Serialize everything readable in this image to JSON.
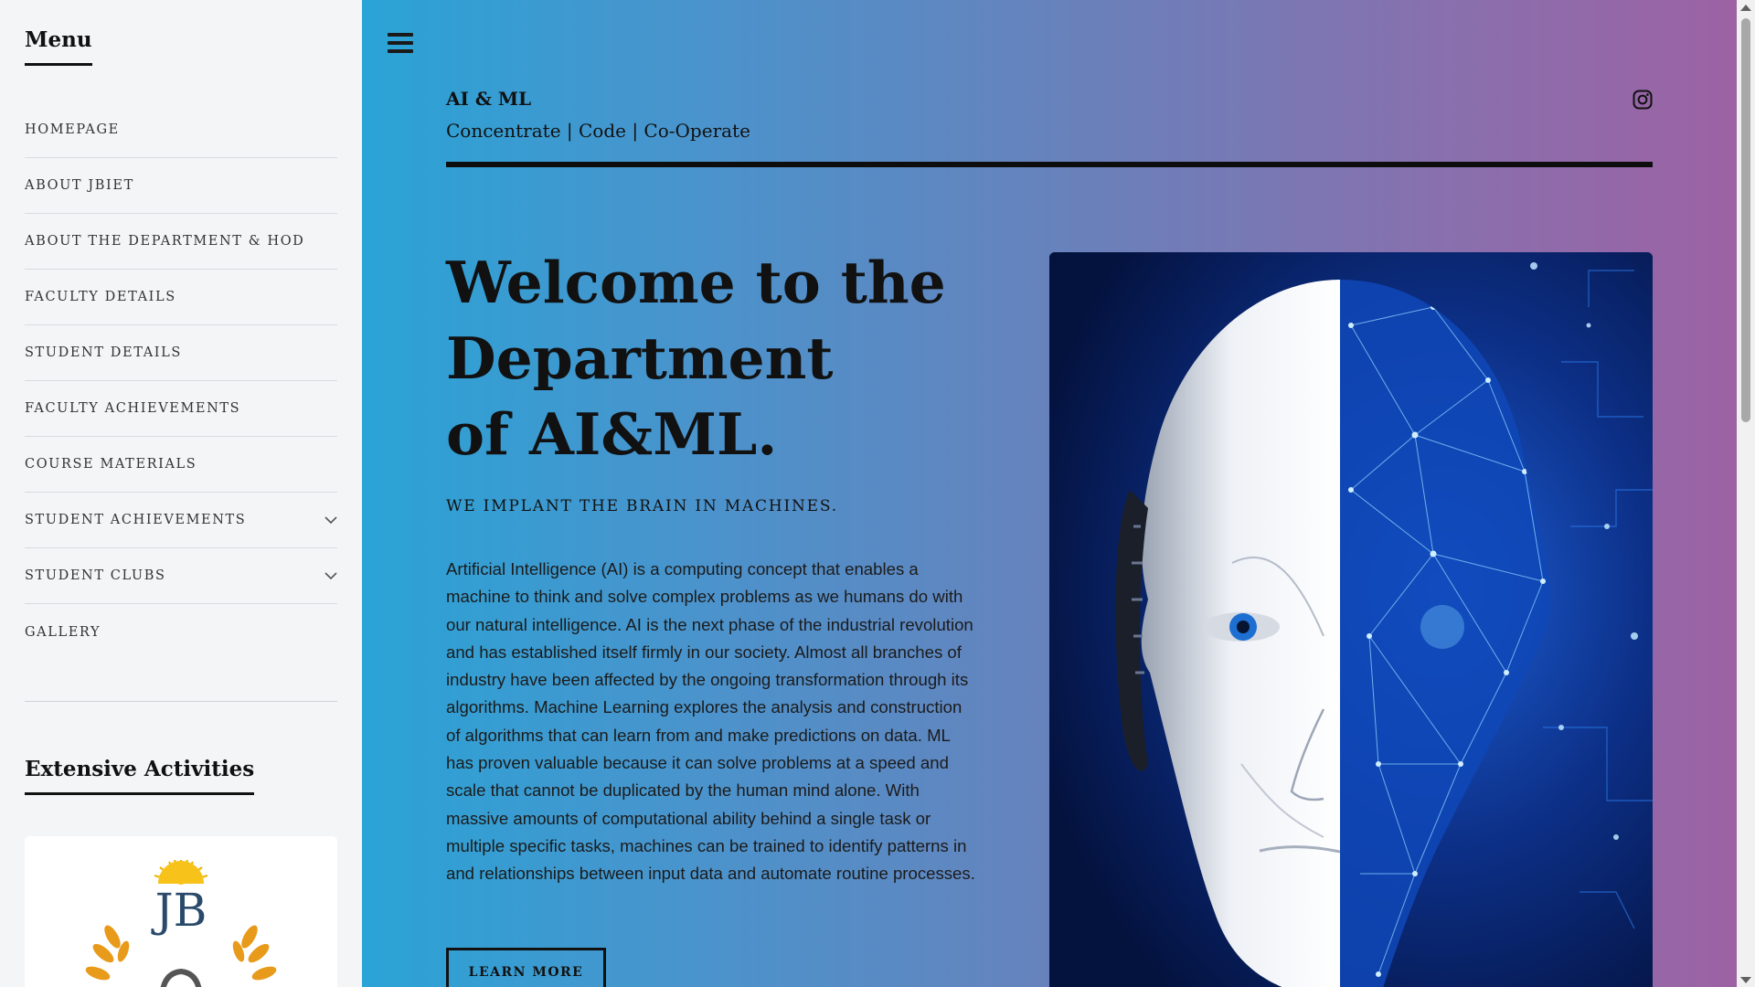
{
  "sidebar": {
    "menu_title": "Menu",
    "items": [
      {
        "label": "HOMEPAGE",
        "has_submenu": false
      },
      {
        "label": "ABOUT JBIET",
        "has_submenu": false
      },
      {
        "label": "ABOUT THE DEPARTMENT & HOD",
        "has_submenu": false
      },
      {
        "label": "FACULTY DETAILS",
        "has_submenu": false
      },
      {
        "label": "STUDENT DETAILS",
        "has_submenu": false
      },
      {
        "label": "FACULTY ACHIEVEMENTS",
        "has_submenu": false
      },
      {
        "label": "COURSE MATERIALS",
        "has_submenu": false
      },
      {
        "label": "STUDENT ACHIEVEMENTS",
        "has_submenu": true
      },
      {
        "label": "STUDENT CLUBS",
        "has_submenu": true
      },
      {
        "label": "GALLERY",
        "has_submenu": false
      }
    ],
    "activities_title": "Extensive Activities",
    "logo_text": "JB"
  },
  "header": {
    "site_title": "AI & ML",
    "tagline": "Concentrate | Code | Co-Operate",
    "social_icon": "instagram-icon"
  },
  "hero": {
    "heading_lines": [
      "Welcome to the",
      "Department",
      "of AI&ML."
    ],
    "subheading": "WE IMPLANT THE BRAIN IN MACHINES.",
    "body": "Artificial Intelligence (AI) is a computing concept that enables a machine to think and solve complex problems as we humans do with our natural intelligence. AI is the next phase of the industrial revolution and has established itself firmly in our society. Almost all branches of industry have been affected by the ongoing transformation through its algorithms. Machine Learning explores the analysis and construction of algorithms that can learn from and make predictions on data. ML has proven valuable because it can solve problems at a speed and scale that cannot be duplicated by the human mind alone. With massive amounts of computational ability behind a single task or multiple specific tasks, machines can be trained to identify patterns in and relationships between input data and automate routine processes.",
    "button_label": "LEARN MORE",
    "image_icon": "ai-robot-face-image"
  },
  "colors": {
    "gradient_start": "#2aa3d6",
    "gradient_end": "#9c62a4",
    "sidebar_bg": "#f4f5f7",
    "text": "#111111"
  }
}
